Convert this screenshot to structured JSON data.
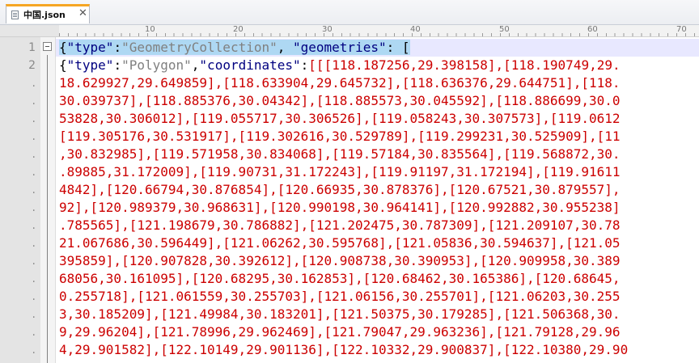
{
  "tab": {
    "title": "中国.json",
    "close_glyph": "✕"
  },
  "ruler": {
    "marks": [
      "10",
      "20",
      "30",
      "40",
      "50",
      "60",
      "70"
    ]
  },
  "gutter": {
    "line1": "1",
    "line2": "2",
    "dot": "."
  },
  "line1": {
    "brace": "{",
    "key1": "\"type\"",
    "colon1": ":",
    "val1": "\"GeometryCollection\"",
    "comma1": ", ",
    "key2": "\"geometries\"",
    "colon2": ": ",
    "bracket": "["
  },
  "line2": {
    "brace": "{",
    "key1": "\"type\"",
    "colon1": ":",
    "val1": "\"Polygon\"",
    "comma1": ",",
    "key2": "\"coordinates\"",
    "colon2": ":",
    "rest": "[[[118.187256,29.398158],[118.190749,29."
  },
  "wrapped_lines": [
    "18.629927,29.649859],[118.633904,29.645732],[118.636376,29.644751],[118.",
    "30.039737],[118.885376,30.04342],[118.885573,30.045592],[118.886699,30.0",
    "53828,30.306012],[119.055717,30.306526],[119.058243,30.307573],[119.0612",
    "[119.305176,30.531917],[119.302616,30.529789],[119.299231,30.525909],[11",
    ",30.832985],[119.571958,30.834068],[119.57184,30.835564],[119.568872,30.",
    ".89885,31.172009],[119.90731,31.172243],[119.91197,31.172194],[119.91611",
    "4842],[120.66794,30.876854],[120.66935,30.878376],[120.67521,30.879557],",
    "92],[120.989379,30.968631],[120.990198,30.964141],[120.992882,30.955238]",
    ".785565],[121.198679,30.786882],[121.202475,30.787309],[121.209107,30.78",
    "21.067686,30.596449],[121.06262,30.595768],[121.05836,30.594637],[121.05",
    "395859],[120.907828,30.392612],[120.908738,30.390953],[120.909958,30.389",
    "68056,30.161095],[120.68295,30.162853],[120.68462,30.165386],[120.68645,",
    "0.255718],[121.061559,30.255703],[121.06156,30.255701],[121.06203,30.255",
    "3,30.185209],[121.49984,30.183201],[121.50375,30.179285],[121.506368,30.",
    "9,29.96204],[121.78996,29.962469],[121.79047,29.963236],[121.79128,29.96",
    "4,29.901582],[122.10149,29.901136],[122.10332,29.900837],[122.10380,29.90"
  ]
}
